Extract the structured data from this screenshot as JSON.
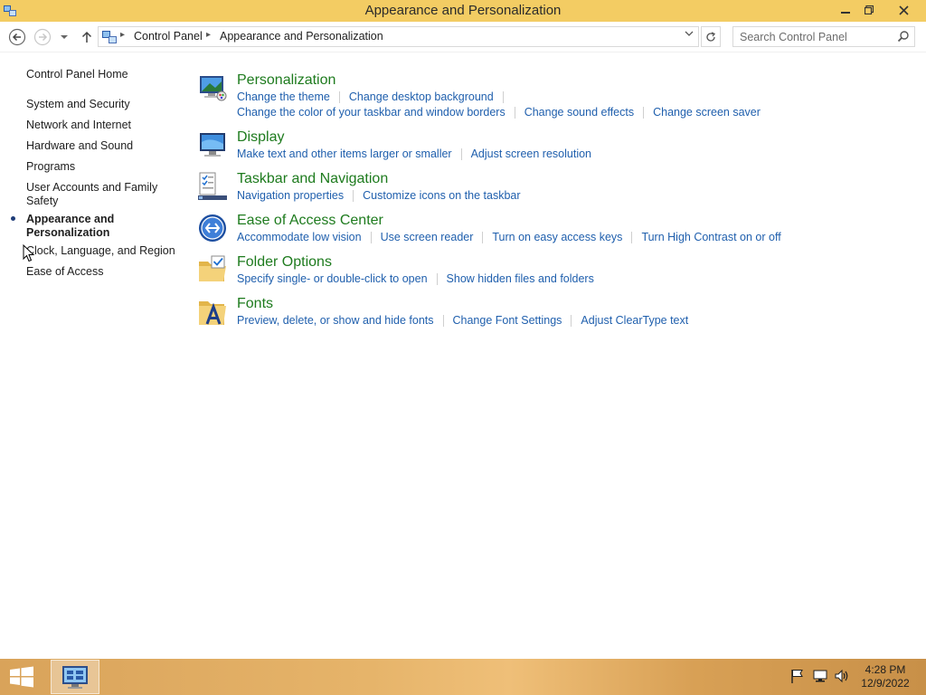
{
  "window": {
    "title": "Appearance and Personalization"
  },
  "address": {
    "crumbs": [
      "Control Panel",
      "Appearance and Personalization"
    ]
  },
  "search": {
    "placeholder": "Search Control Panel"
  },
  "leftnav": {
    "home": "Control Panel Home",
    "items": [
      {
        "label": "System and Security"
      },
      {
        "label": "Network and Internet"
      },
      {
        "label": "Hardware and Sound"
      },
      {
        "label": "Programs"
      },
      {
        "label": "User Accounts and Family Safety"
      },
      {
        "label": "Appearance and Personalization",
        "current": true
      },
      {
        "label": "Clock, Language, and Region"
      },
      {
        "label": "Ease of Access"
      }
    ]
  },
  "categories": [
    {
      "title": "Personalization",
      "icon": "personalization-icon",
      "link_rows": [
        [
          "Change the theme",
          "Change desktop background"
        ],
        [
          "Change the color of your taskbar and window borders",
          "Change sound effects",
          "Change screen saver"
        ]
      ]
    },
    {
      "title": "Display",
      "icon": "display-icon",
      "link_rows": [
        [
          "Make text and other items larger or smaller",
          "Adjust screen resolution"
        ]
      ]
    },
    {
      "title": "Taskbar and Navigation",
      "icon": "taskbar-icon",
      "link_rows": [
        [
          "Navigation properties",
          "Customize icons on the taskbar"
        ]
      ]
    },
    {
      "title": "Ease of Access Center",
      "icon": "ease-of-access-icon",
      "link_rows": [
        [
          "Accommodate low vision",
          "Use screen reader",
          "Turn on easy access keys",
          "Turn High Contrast on or off"
        ]
      ]
    },
    {
      "title": "Folder Options",
      "icon": "folder-options-icon",
      "link_rows": [
        [
          "Specify single- or double-click to open",
          "Show hidden files and folders"
        ]
      ]
    },
    {
      "title": "Fonts",
      "icon": "fonts-icon",
      "link_rows": [
        [
          "Preview, delete, or show and hide fonts",
          "Change Font Settings",
          "Adjust ClearType text"
        ]
      ]
    }
  ],
  "taskbar": {
    "time": "4:28 PM",
    "date": "12/9/2022"
  },
  "colors": {
    "titlebar": "#f3cc63",
    "heading_green": "#1e7b1e",
    "link_blue": "#1f5fad"
  }
}
